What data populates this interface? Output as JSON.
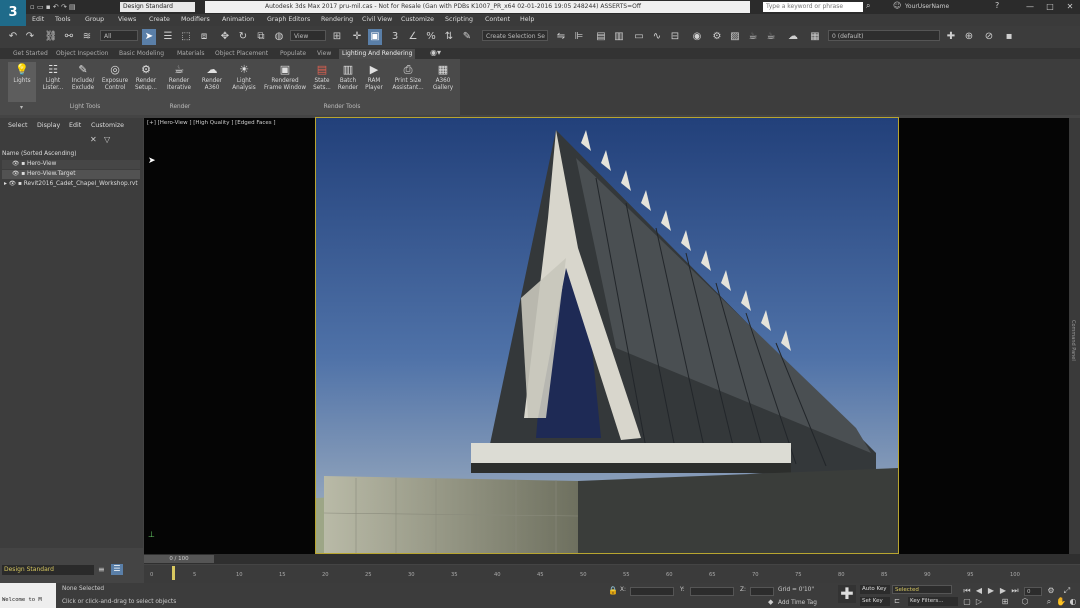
{
  "title_bar": {
    "workspace": "Design Standard",
    "app_title": "Autodesk 3ds Max 2017  pru-mil.cas  - Not for Resale (Gan with PDBs K1007_PR_x64 02-01-2016 19:05 248244) ASSERTS=Off",
    "search_placeholder": "Type a keyword or phrase",
    "user_name": "YourUserName",
    "minimize": "—",
    "maximize": "□",
    "close": "✕"
  },
  "menu": [
    "Edit",
    "Tools",
    "Group",
    "Views",
    "Create",
    "Modifiers",
    "Animation",
    "Graph Editors",
    "Rendering",
    "Civil View",
    "Customize",
    "Scripting",
    "Content",
    "Help"
  ],
  "toolbar": {
    "filter_value": "All",
    "view_value": "View",
    "selection_set_placeholder": "Create Selection Se",
    "layer_value": "0 (default)"
  },
  "ribbon_tabs": {
    "items": [
      "Get Started",
      "Object Inspection",
      "Basic Modeling",
      "Materials",
      "Object Placement",
      "Populate",
      "View",
      "Lighting And Rendering"
    ],
    "active_index": 7
  },
  "ribbon": {
    "buttons": [
      {
        "line1": "Lights",
        "line2": ""
      },
      {
        "line1": "Light",
        "line2": "Lister..."
      },
      {
        "line1": "Include/",
        "line2": "Exclude"
      },
      {
        "line1": "Exposure",
        "line2": "Control"
      },
      {
        "line1": "Render",
        "line2": "Setup..."
      },
      {
        "line1": "Render",
        "line2": "Iterative"
      },
      {
        "line1": "Render",
        "line2": "A360"
      },
      {
        "line1": "Light",
        "line2": "Analysis"
      },
      {
        "line1": "Rendered",
        "line2": "Frame Window"
      },
      {
        "line1": "State",
        "line2": "Sets..."
      },
      {
        "line1": "Batch",
        "line2": "Render"
      },
      {
        "line1": "RAM",
        "line2": "Player"
      },
      {
        "line1": "Print Size",
        "line2": "Assistant..."
      },
      {
        "line1": "A360",
        "line2": "Gallery"
      }
    ],
    "groups": [
      "Light Tools",
      "Render",
      "Render Tools"
    ]
  },
  "scene_explorer": {
    "menu": [
      "Select",
      "Display",
      "Edit",
      "Customize"
    ],
    "sort_label": "Name (Sorted Ascending)",
    "items": [
      "Hero-View",
      "Hero-View.Target",
      "Revit2016_Cadet_Chapel_Workshop.rvt"
    ]
  },
  "viewport": {
    "label": "[+] [Hero-View ] [High Quality ] [Edged Faces ]"
  },
  "right_panel_label": "Command Panel",
  "timeline": {
    "slider": "0 / 100",
    "ticks": [
      "0",
      "5",
      "10",
      "15",
      "20",
      "25",
      "30",
      "35",
      "40",
      "45",
      "50",
      "55",
      "60",
      "65",
      "70",
      "75",
      "80",
      "85",
      "90",
      "95",
      "100"
    ]
  },
  "status": {
    "workspace_bottom": "Design Standard",
    "maxscript": "Welcome to M",
    "selection": "None Selected",
    "prompt": "Click or click-and-drag to select objects",
    "x": "X:",
    "y": "Y:",
    "z": "Z:",
    "grid": "Grid = 0'10\"",
    "add_time_tag": "Add Time Tag",
    "auto_key": "Auto Key",
    "set_key": "Set Key",
    "selected": "Selected",
    "key_filters": "Key Filters...",
    "frame": "0"
  },
  "colors": {
    "accent": "#5a7fa8",
    "viewport_border": "#b8a530"
  }
}
